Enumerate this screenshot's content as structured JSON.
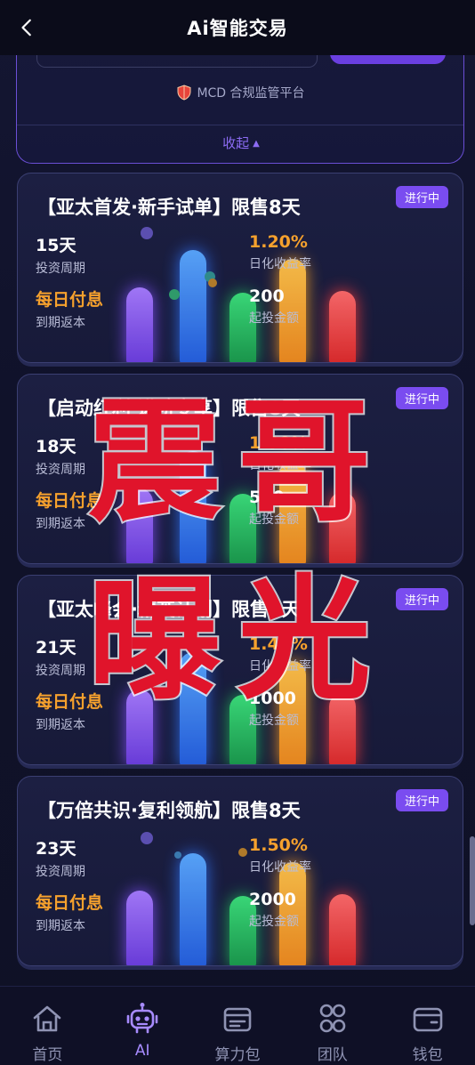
{
  "header": {
    "title": "Ai智能交易"
  },
  "top_panel": {
    "platform_text": "MCD 合规监管平台",
    "collapse_label": "收起",
    "collapse_caret": "▲"
  },
  "cards": [
    {
      "title": "【亚太首发·新手试单】限售8天",
      "status": "进行中",
      "period_value": "15天",
      "period_label": "投资周期",
      "rate_value": "1.20%",
      "rate_label": "日化收益率",
      "payout_value": "每日付息",
      "payout_label": "到期返本",
      "min_value": "200",
      "min_label": "起投金额"
    },
    {
      "title": "【启动红利·进阶专享】限售8天",
      "status": "进行中",
      "period_value": "18天",
      "period_label": "投资周期",
      "rate_value": "1.30%",
      "rate_label": "日化收益率",
      "payout_value": "每日付息",
      "payout_label": "到期返本",
      "min_value": "500",
      "min_label": "起投金额"
    },
    {
      "title": "【亚太峰会·精英计划】限售8天",
      "status": "进行中",
      "period_value": "21天",
      "period_label": "投资周期",
      "rate_value": "1.40%",
      "rate_label": "日化收益率",
      "payout_value": "每日付息",
      "payout_label": "到期返本",
      "min_value": "1000",
      "min_label": "起投金额"
    },
    {
      "title": "【万倍共识·复利领航】限售8天",
      "status": "进行中",
      "period_value": "23天",
      "period_label": "投资周期",
      "rate_value": "1.50%",
      "rate_label": "日化收益率",
      "payout_value": "每日付息",
      "payout_label": "到期返本",
      "min_value": "2000",
      "min_label": "起投金额"
    }
  ],
  "watermark": {
    "line1": "震哥",
    "line2": "曝光"
  },
  "nav": [
    {
      "label": "首页",
      "icon": "home-icon"
    },
    {
      "label": "AI",
      "icon": "robot-icon"
    },
    {
      "label": "算力包",
      "icon": "package-icon"
    },
    {
      "label": "团队",
      "icon": "team-icon"
    },
    {
      "label": "钱包",
      "icon": "wallet-icon"
    }
  ],
  "colors": {
    "accent": "#7a4cf0",
    "rate": "#f6a12d",
    "watermark": "#e0142b"
  }
}
